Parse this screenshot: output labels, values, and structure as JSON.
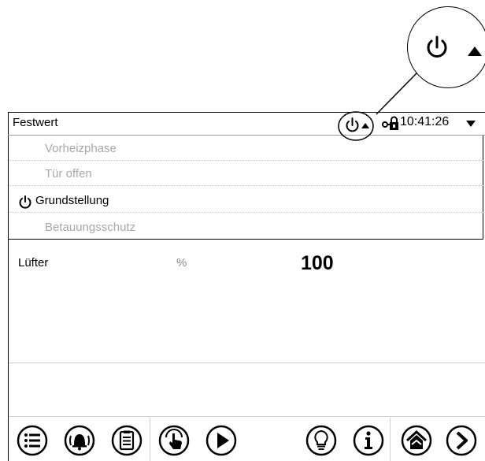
{
  "header": {
    "title": "Festwert",
    "time": "10:41:26",
    "icons": [
      "power-icon",
      "arrow-up-icon",
      "door-lock-icon",
      "dropdown-arrow-icon"
    ]
  },
  "menu": {
    "items": [
      {
        "label": "Vorheizphase",
        "active": false
      },
      {
        "label": "Tür offen",
        "active": false
      },
      {
        "label": "Grundstellung",
        "active": true,
        "icon": "power-icon"
      },
      {
        "label": "Betauungsschutz",
        "active": false
      }
    ]
  },
  "values": {
    "fan_label": "Lüfter",
    "fan_unit": "%",
    "fan_value": "100"
  },
  "toolbar": {
    "buttons": [
      "menu-list",
      "alarm",
      "notes",
      "download",
      "play",
      "light",
      "info",
      "home",
      "next"
    ]
  },
  "colors": {
    "active_text": "#000000",
    "disabled_text": "#a8a8a8",
    "separator": "#cfcfcf"
  }
}
